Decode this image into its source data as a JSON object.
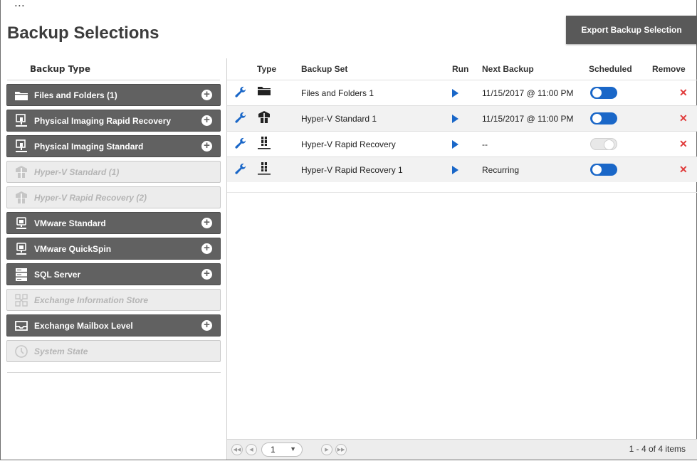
{
  "header": {
    "caption": "...",
    "title": "Backup Selections",
    "export_label": "Export Backup Selection"
  },
  "left": {
    "column_header": "Backup Type",
    "types": [
      {
        "label": "Files and Folders (1)",
        "icon": "folder-icon",
        "enabled": true
      },
      {
        "label": "Physical Imaging Rapid Recovery",
        "icon": "server-monitor-icon",
        "enabled": true
      },
      {
        "label": "Physical Imaging Standard",
        "icon": "server-monitor-icon",
        "enabled": true
      },
      {
        "label": "Hyper-V Standard (1)",
        "icon": "hyperv-icon",
        "enabled": false
      },
      {
        "label": "Hyper-V Rapid Recovery (2)",
        "icon": "hyperv-icon",
        "enabled": false
      },
      {
        "label": "VMware Standard",
        "icon": "vmware-icon",
        "enabled": true
      },
      {
        "label": "VMware QuickSpin",
        "icon": "vmware-icon",
        "enabled": true
      },
      {
        "label": "SQL Server",
        "icon": "database-icon",
        "enabled": true
      },
      {
        "label": "Exchange Information Store",
        "icon": "exchange-icon",
        "enabled": false
      },
      {
        "label": "Exchange Mailbox Level",
        "icon": "mailbox-icon",
        "enabled": true
      },
      {
        "label": "System State",
        "icon": "system-state-icon",
        "enabled": false
      }
    ]
  },
  "grid": {
    "columns": {
      "type": "Type",
      "backup_set": "Backup Set",
      "run": "Run",
      "next_backup": "Next Backup",
      "scheduled": "Scheduled",
      "remove": "Remove"
    },
    "rows": [
      {
        "type_icon": "folder-icon",
        "backup_set": "Files and Folders 1",
        "next_backup": "11/15/2017 @ 11:00 PM",
        "scheduled": true
      },
      {
        "type_icon": "hyperv-icon",
        "backup_set": "Hyper-V Standard 1",
        "next_backup": "11/15/2017 @ 11:00 PM",
        "scheduled": true
      },
      {
        "type_icon": "hyperv-rr-icon",
        "backup_set": "Hyper-V Rapid Recovery",
        "next_backup": "--",
        "scheduled": false
      },
      {
        "type_icon": "hyperv-rr-icon",
        "backup_set": "Hyper-V Rapid Recovery 1",
        "next_backup": "Recurring",
        "scheduled": true
      }
    ],
    "pager": {
      "current_page": "1",
      "summary": "1 - 4 of 4 items"
    }
  },
  "colors": {
    "accent": "#1a67c8",
    "enabled_item": "#616161",
    "remove": "#e03a3a"
  }
}
